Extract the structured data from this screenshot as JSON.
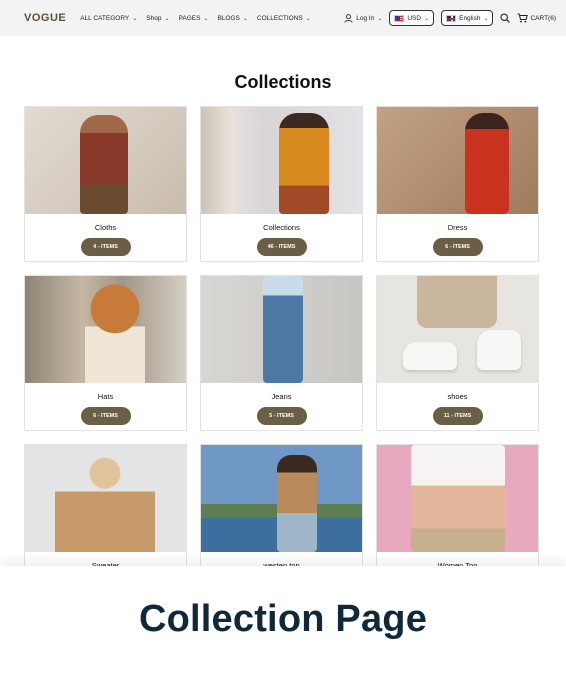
{
  "header": {
    "logo": "VOGUE",
    "nav": [
      {
        "label": "ALL CATEGORY"
      },
      {
        "label": "Shop"
      },
      {
        "label": "PAGES"
      },
      {
        "label": "BLOGS"
      },
      {
        "label": "COLLECTIONS"
      }
    ],
    "login_label": "Log In",
    "currency": "USD",
    "language": "English",
    "cart_label": "CART(6)"
  },
  "main": {
    "title": "Collections",
    "collections": [
      {
        "name": "Cloths",
        "count": "4 - ITEMS",
        "bg": "#d9cfc4"
      },
      {
        "name": "Collections",
        "count": "46 - ITEMS",
        "bg": "#e8e2e4"
      },
      {
        "name": "Dress",
        "count": "6 - ITEMS",
        "bg": "#b08a6e"
      },
      {
        "name": "Hats",
        "count": "6 - ITEMS",
        "bg": "#a9a094"
      },
      {
        "name": "Jeans",
        "count": "5 - ITEMS",
        "bg": "#d5d3cf"
      },
      {
        "name": "shoes",
        "count": "11 - ITEMS",
        "bg": "#e6e4de"
      },
      {
        "name": "Sweater",
        "count": "",
        "bg": "#e4e4e4"
      },
      {
        "name": "westen top",
        "count": "",
        "bg": "#5f8ab8"
      },
      {
        "name": "Women Top",
        "count": "",
        "bg": "#e8a8bd"
      }
    ]
  },
  "banner": {
    "title": "Collection Page"
  },
  "colors": {
    "badge": "#6a5e45",
    "logo": "#5b4f37",
    "banner_text": "#10293a"
  }
}
